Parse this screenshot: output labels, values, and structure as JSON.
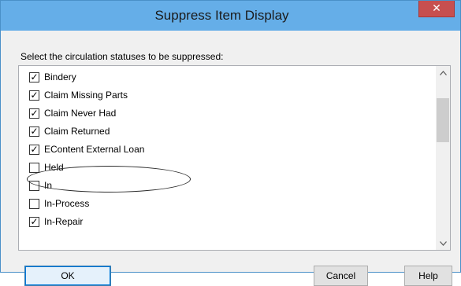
{
  "dialog": {
    "title": "Suppress Item Display",
    "close_glyph": "✕",
    "prompt": "Select the circulation statuses to be suppressed:"
  },
  "statuses": [
    {
      "label": "Bindery",
      "checked": true
    },
    {
      "label": "Claim Missing Parts",
      "checked": true
    },
    {
      "label": "Claim Never Had",
      "checked": true
    },
    {
      "label": "Claim Returned",
      "checked": true
    },
    {
      "label": "EContent External Loan",
      "checked": true
    },
    {
      "label": "Held",
      "checked": false
    },
    {
      "label": "In",
      "checked": false
    },
    {
      "label": "In-Process",
      "checked": false
    },
    {
      "label": "In-Repair",
      "checked": true
    }
  ],
  "scrollbar": {
    "up_icon": "chevron-up-icon",
    "down_icon": "chevron-down-icon"
  },
  "buttons": {
    "ok": "OK",
    "cancel": "Cancel",
    "help": "Help"
  },
  "colors": {
    "titlebar": "#65aee8",
    "close": "#c74f4f",
    "ok_border": "#3c7fb1"
  }
}
